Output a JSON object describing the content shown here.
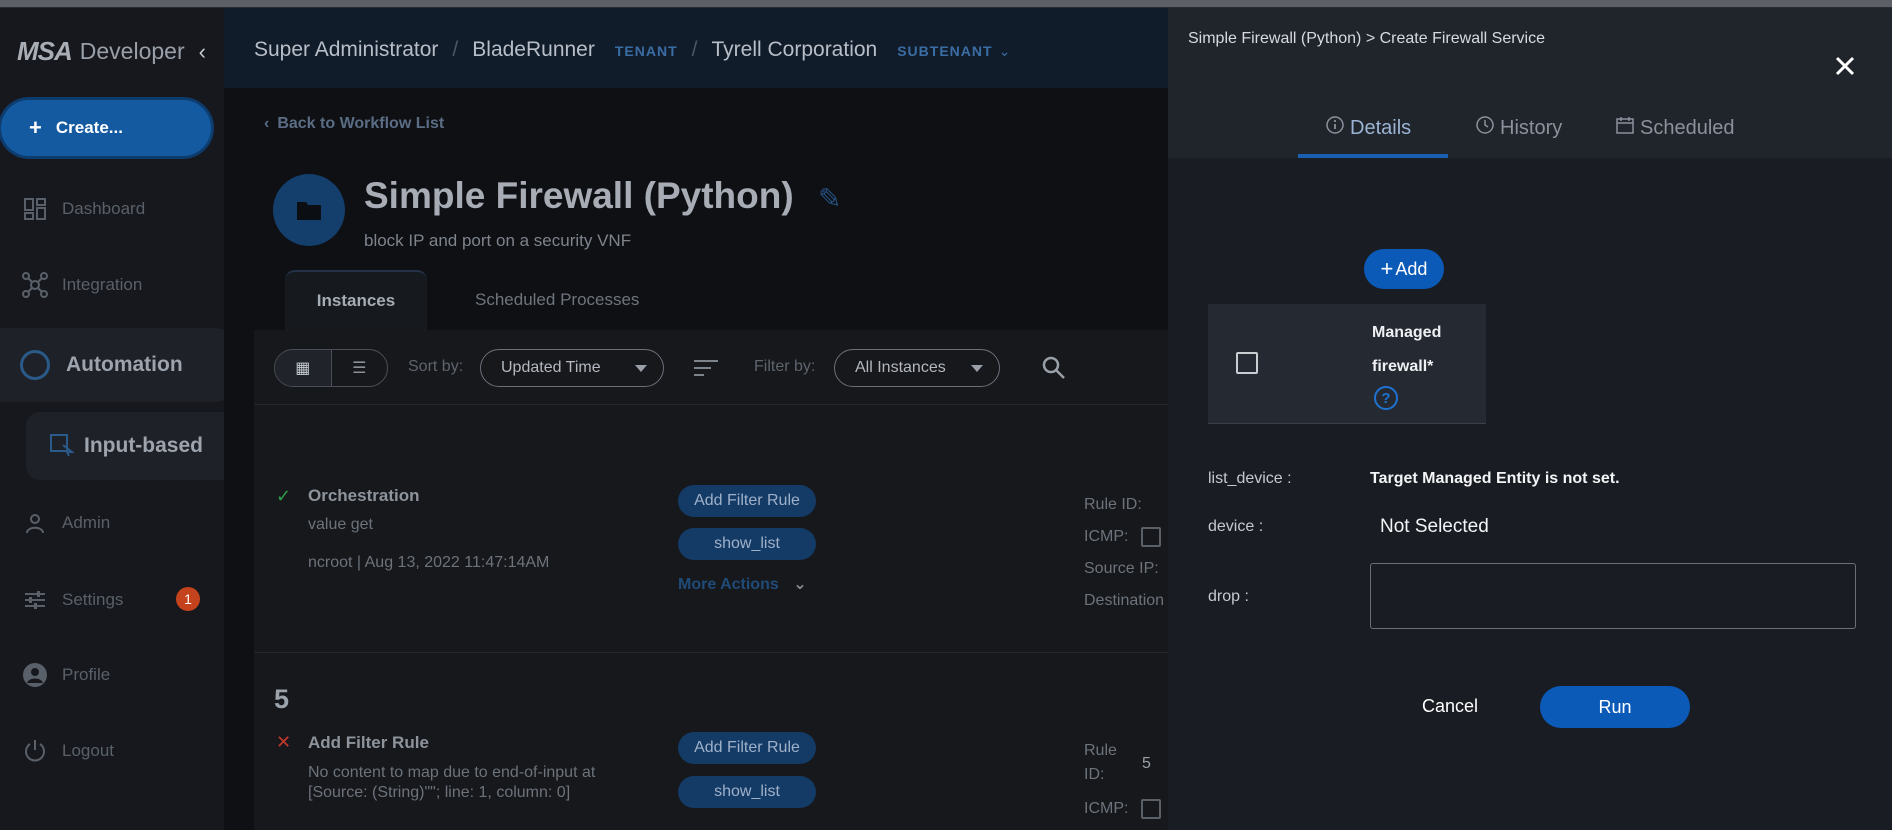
{
  "brand": {
    "logo": "MSA",
    "app_name": "Developer"
  },
  "sidebar": {
    "create_label": "Create...",
    "items": [
      {
        "label": "Dashboard",
        "icon": "dashboard-icon"
      },
      {
        "label": "Integration",
        "icon": "integration-icon"
      },
      {
        "label": "Automation",
        "icon": "automation-icon"
      },
      {
        "label": "Input-based",
        "icon": "input-based-icon"
      },
      {
        "label": "Admin",
        "icon": "admin-icon"
      },
      {
        "label": "Settings",
        "icon": "settings-icon",
        "badge": "1"
      },
      {
        "label": "Profile",
        "icon": "profile-icon"
      },
      {
        "label": "Logout",
        "icon": "logout-icon"
      }
    ]
  },
  "header": {
    "crumb1": "Super Administrator",
    "crumb2": "BladeRunner",
    "crumb2_tag": "TENANT",
    "crumb3": "Tyrell Corporation",
    "crumb3_tag": "SUBTENANT"
  },
  "workflow": {
    "back_label": "Back to Workflow List",
    "title": "Simple Firewall (Python)",
    "description": "block IP and port on a security VNF",
    "tabs": [
      "Instances",
      "Scheduled Processes"
    ]
  },
  "toolbar": {
    "sort_label": "Sort by:",
    "sort_value": "Updated Time",
    "filter_label": "Filter by:",
    "filter_value": "All Instances"
  },
  "instances": [
    {
      "number": "",
      "status": "success",
      "title": "Orchestration",
      "subtitle": "value get",
      "meta": "ncroot | Aug 13, 2022 11:47:14AM",
      "actions": [
        "Add Filter Rule",
        "show_list"
      ],
      "more": "More Actions",
      "fields": {
        "rule_id": "Rule ID:",
        "icmp": "ICMP:",
        "source_ip": "Source IP:",
        "destination": "Destination"
      }
    },
    {
      "number": "5",
      "status": "failed",
      "title": "Add Filter Rule",
      "subtitle": "No content to map due to end-of-input at [Source: (String)\"\"; line: 1, column: 0]",
      "actions": [
        "Add Filter Rule",
        "show_list"
      ],
      "fields": {
        "rule_id_a": "Rule",
        "rule_id_b": "ID:",
        "rule_id_value": "5",
        "icmp": "ICMP:"
      }
    }
  ],
  "drawer": {
    "breadcrumb": "Simple Firewall (Python) > Create Firewall Service",
    "tabs": [
      "Details",
      "History",
      "Scheduled"
    ],
    "active_tab": "Details",
    "add_label": "Add",
    "table_header_line1": "Managed",
    "table_header_line2": "firewall*",
    "help_glyph": "?",
    "fields": {
      "list_device_label": "list_device :",
      "list_device_value": "Target Managed Entity is not set.",
      "device_label": "device :",
      "device_value": "Not Selected",
      "drop_label": "drop :",
      "drop_value": ""
    },
    "cancel_label": "Cancel",
    "run_label": "Run"
  },
  "colors": {
    "accent": "#0b5ab8",
    "badge": "#c4421c",
    "success": "#2e9d4a",
    "error": "#c0392b"
  }
}
